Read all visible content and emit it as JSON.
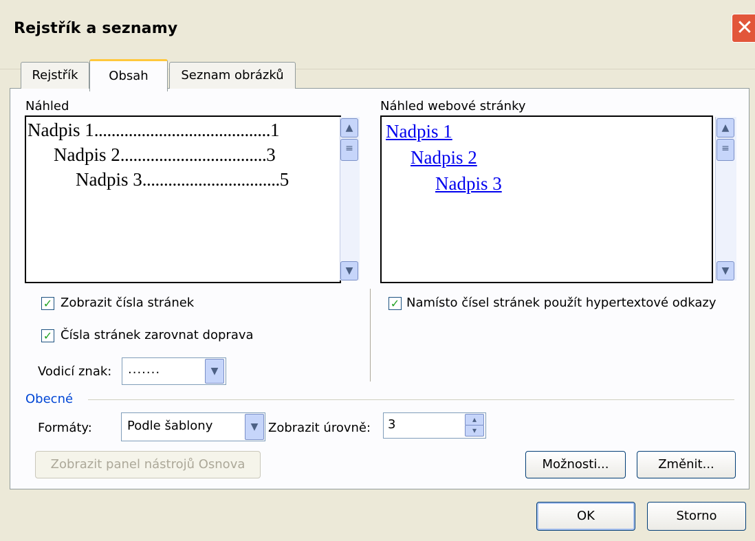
{
  "window": {
    "title": "Rejstřík a seznamy",
    "close_glyph": "✕"
  },
  "tabs": [
    {
      "label": "Rejstřík"
    },
    {
      "label": "Obsah"
    },
    {
      "label": "Seznam obrázků"
    }
  ],
  "print_preview": {
    "label": "Náhled",
    "entries": [
      {
        "text": "Nadpis 1",
        "leader": ".........................................",
        "page": "1"
      },
      {
        "text": "Nadpis 2",
        "leader": "..................................",
        "page": "3"
      },
      {
        "text": "Nadpis 3",
        "leader": "................................",
        "page": "5"
      }
    ]
  },
  "web_preview": {
    "label": "Náhled webové stránky",
    "entries": [
      "Nadpis 1",
      "Nadpis 2",
      "Nadpis 3"
    ]
  },
  "options": {
    "show_page_numbers": {
      "label": "Zobrazit čísla stránek",
      "checked": true
    },
    "right_align": {
      "label": "Čísla stránek zarovnat doprava",
      "checked": true
    },
    "use_hyperlinks": {
      "label": "Namísto čísel stránek použít hypertextové odkazy",
      "checked": true
    },
    "leader": {
      "label": "Vodicí znak:",
      "value": "......."
    }
  },
  "general": {
    "label": "Obecné",
    "formats": {
      "label": "Formáty:",
      "value": "Podle šablony"
    },
    "levels": {
      "label": "Zobrazit úrovně:",
      "value": "3"
    }
  },
  "buttons": {
    "outline_toolbar": "Zobrazit panel nástrojů Osnova",
    "options": "Možnosti...",
    "modify": "Změnit...",
    "ok": "OK",
    "cancel": "Storno"
  },
  "icons": {
    "check": "✓",
    "arrow_up": "▲",
    "arrow_down": "▼",
    "grip": "≡",
    "spin_up": "▴",
    "spin_down": "▾"
  },
  "colors": {
    "accent": "#0046D5",
    "link": "#0000EE",
    "dialog": "#ECE9D8",
    "close": "#E2563A"
  }
}
